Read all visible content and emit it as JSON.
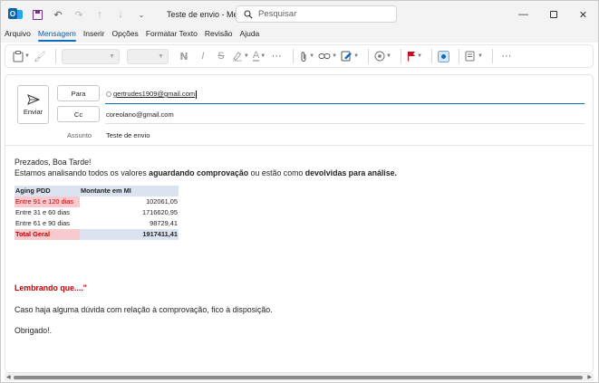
{
  "titlebar": {
    "window_title": "Teste de envio  -  Mensagem (HTML)",
    "search_placeholder": "Pesquisar",
    "app_logo_letter": "O"
  },
  "menu": {
    "items": [
      "Arquivo",
      "Mensagem",
      "Inserir",
      "Opções",
      "Formatar Texto",
      "Revisão",
      "Ajuda"
    ],
    "active_index": 1
  },
  "ribbon": {
    "icons": [
      "clipboard-icon",
      "format-painter-icon",
      "bold-icon",
      "italic-icon",
      "strikethrough-icon",
      "highlighter-icon",
      "font-color-icon",
      "more-icon",
      "attach-icon",
      "link-icon",
      "signature-icon",
      "dictate-icon",
      "flag-icon",
      "sensitivity-icon",
      "apps-icon",
      "more-icon"
    ],
    "bold_glyph": "N",
    "italic_glyph": "I",
    "strike_glyph": "S",
    "font_color_glyph": "A"
  },
  "compose": {
    "send_label": "Enviar",
    "to_label": "Para",
    "cc_label": "Cc",
    "subject_label": "Assunto",
    "to_value": "gertrudes1909@gmail.com",
    "cc_value": "coreolano@gmail.com",
    "subject_value": "Teste de envio"
  },
  "body": {
    "greeting": "Prezados, Boa Tarde!",
    "intro_part1": "Estamos analisando todos os valores ",
    "intro_bold1": "aguardando comprovação",
    "intro_part2": " ou estão como ",
    "intro_bold2": "devolvidas para análise.",
    "table": {
      "headers": [
        "Aging PDD",
        "Montante em MI"
      ],
      "rows": [
        {
          "label": "Entre 91 e 120 dias",
          "value": "102061,05"
        },
        {
          "label": "Entre 31 e 60 dias",
          "value": "1716620,95"
        },
        {
          "label": "Entre 61 e 90 dias",
          "value": "98729,41"
        }
      ],
      "total_label": "Total Geral",
      "total_value": "1917411,41"
    },
    "reminder": "Lembrando que....\"",
    "closing_line": "Caso haja alguma dúvida com relação à comprovação, fico à disposição.",
    "signoff": "Obrigado!."
  },
  "colors": {
    "accent": "#0f6cbd",
    "reminder_red": "#c00000",
    "table_header_bg": "#dce3f0",
    "table_highlight_bg": "#f8c9cd"
  }
}
